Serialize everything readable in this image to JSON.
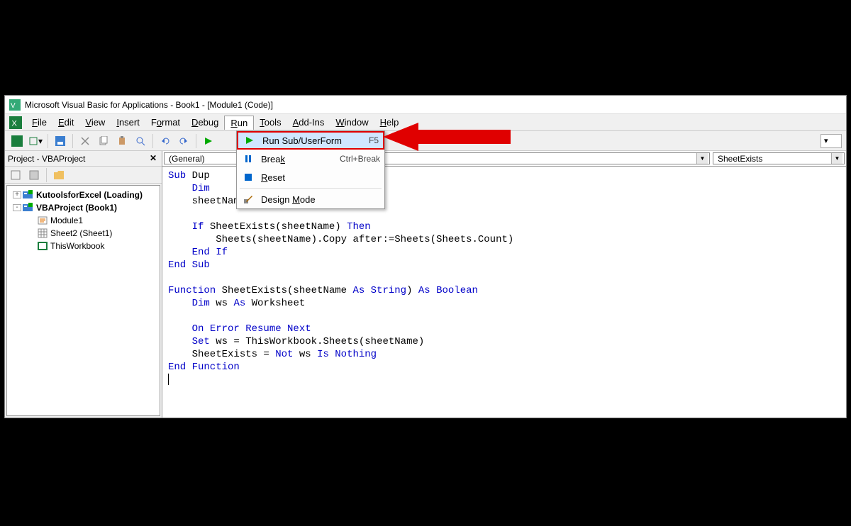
{
  "window": {
    "title": "Microsoft Visual Basic for Applications - Book1 - [Module1 (Code)]"
  },
  "menubar": {
    "items": [
      "File",
      "Edit",
      "View",
      "Insert",
      "Format",
      "Debug",
      "Run",
      "Tools",
      "Add-Ins",
      "Window",
      "Help"
    ],
    "active_index": 6,
    "underlines": [
      "F",
      "E",
      "V",
      "I",
      "o",
      "D",
      "R",
      "T",
      "A",
      "W",
      "H"
    ]
  },
  "run_menu": {
    "items": [
      {
        "icon": "play-icon",
        "label": "Run Sub/UserForm",
        "shortcut": "F5",
        "highlighted": true,
        "underline": ""
      },
      {
        "icon": "pause-icon",
        "label": "Break",
        "shortcut": "Ctrl+Break",
        "underline": "k"
      },
      {
        "icon": "reset-icon",
        "label": "Reset",
        "shortcut": "",
        "underline": "R"
      },
      {
        "sep": true
      },
      {
        "icon": "design-icon",
        "label": "Design Mode",
        "shortcut": "",
        "underline": "M"
      }
    ]
  },
  "project_panel": {
    "title": "Project - VBAProject",
    "tree": [
      {
        "indent": 0,
        "toggle": "+",
        "icon": "vba-proj-icon",
        "label": "KutoolsforExcel (Loading)",
        "bold": true
      },
      {
        "indent": 0,
        "toggle": "-",
        "icon": "vba-proj-icon",
        "label": "VBAProject (Book1)",
        "bold": true
      },
      {
        "indent": 1,
        "toggle": "",
        "icon": "module-icon",
        "label": "Module1",
        "bold": false
      },
      {
        "indent": 1,
        "toggle": "",
        "icon": "sheet-icon",
        "label": "Sheet2 (Sheet1)",
        "bold": false
      },
      {
        "indent": 1,
        "toggle": "",
        "icon": "workbook-icon",
        "label": "ThisWorkbook",
        "bold": false
      }
    ]
  },
  "code_header": {
    "left": "(General)",
    "right": "SheetExists"
  },
  "code": {
    "lines": [
      {
        "t": "kw",
        "s": "Sub "
      },
      {
        "t": "",
        "s": "Dup"
      },
      {
        "nl": 1
      },
      {
        "t": "",
        "s": "    "
      },
      {
        "t": "kw",
        "s": "Dim"
      },
      {
        "nl": 1
      },
      {
        "t": "",
        "s": "    sheetName = \"Sheet1\""
      },
      {
        "nl": 1
      },
      {
        "nl": 1
      },
      {
        "t": "",
        "s": "    "
      },
      {
        "t": "kw",
        "s": "If"
      },
      {
        "t": "",
        "s": " SheetExists(sheetName) "
      },
      {
        "t": "kw",
        "s": "Then"
      },
      {
        "nl": 1
      },
      {
        "t": "",
        "s": "        Sheets(sheetName).Copy after:=Sheets(Sheets.Count)"
      },
      {
        "nl": 1
      },
      {
        "t": "",
        "s": "    "
      },
      {
        "t": "kw",
        "s": "End If"
      },
      {
        "nl": 1
      },
      {
        "t": "kw",
        "s": "End Sub"
      },
      {
        "nl": 1
      },
      {
        "nl": 1
      },
      {
        "t": "kw",
        "s": "Function"
      },
      {
        "t": "",
        "s": " SheetExists(sheetName "
      },
      {
        "t": "kw",
        "s": "As String"
      },
      {
        "t": "",
        "s": ") "
      },
      {
        "t": "kw",
        "s": "As Boolean"
      },
      {
        "nl": 1
      },
      {
        "t": "",
        "s": "    "
      },
      {
        "t": "kw",
        "s": "Dim"
      },
      {
        "t": "",
        "s": " ws "
      },
      {
        "t": "kw",
        "s": "As"
      },
      {
        "t": "",
        "s": " Worksheet"
      },
      {
        "nl": 1
      },
      {
        "nl": 1
      },
      {
        "t": "",
        "s": "    "
      },
      {
        "t": "kw",
        "s": "On Error Resume Next"
      },
      {
        "nl": 1
      },
      {
        "t": "",
        "s": "    "
      },
      {
        "t": "kw",
        "s": "Set"
      },
      {
        "t": "",
        "s": " ws = ThisWorkbook.Sheets(sheetName)"
      },
      {
        "nl": 1
      },
      {
        "t": "",
        "s": "    SheetExists = "
      },
      {
        "t": "kw",
        "s": "Not"
      },
      {
        "t": "",
        "s": " ws "
      },
      {
        "t": "kw",
        "s": "Is Nothing"
      },
      {
        "nl": 1
      },
      {
        "t": "kw",
        "s": "End Function"
      },
      {
        "nl": 1
      }
    ]
  }
}
